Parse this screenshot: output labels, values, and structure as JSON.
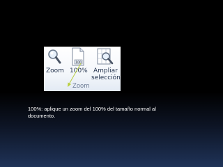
{
  "ribbon": {
    "zoom_button": {
      "label": "Zoom",
      "icon": "magnifier-icon"
    },
    "hundred_button": {
      "label": "100%",
      "icon": "page-100-icon"
    },
    "ampliar_button": {
      "label_line1": "Ampliar",
      "label_line2": "selección",
      "icon": "zoom-selection-icon"
    },
    "group_label": "Zoom"
  },
  "caption": "100%: aplique un zoom del 100% del tamaño normal al documento.",
  "colors": {
    "arrow": "#b9cf3f",
    "ribbon_text": "#1f2f4a",
    "group_text": "#6a7a93"
  }
}
